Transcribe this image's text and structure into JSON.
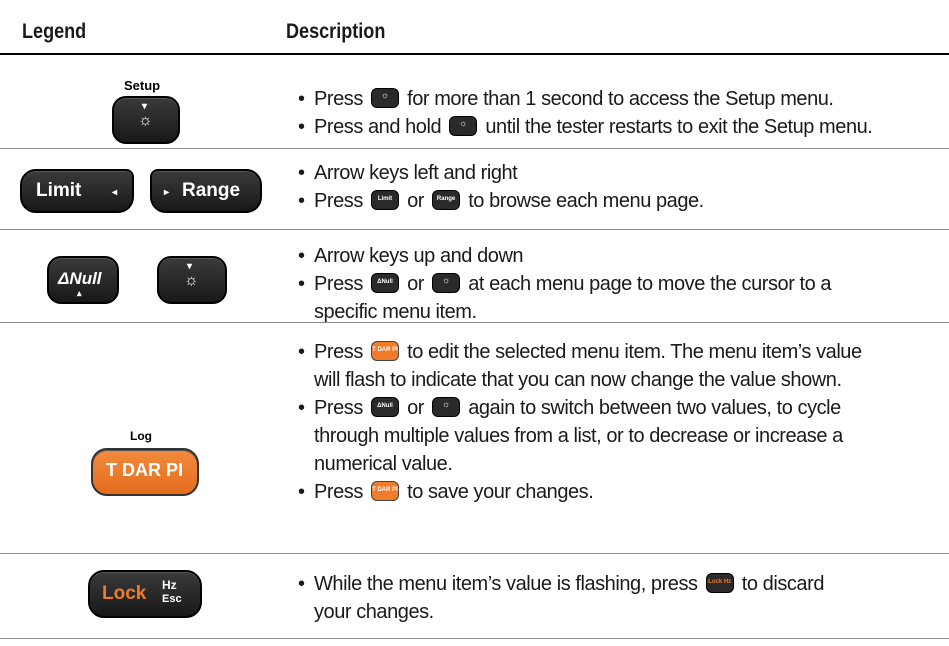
{
  "header": {
    "legend": "Legend",
    "description": "Description"
  },
  "rows": [
    {
      "keys": [
        {
          "above": "Setup",
          "arrow": "▾",
          "icon": "☼"
        }
      ],
      "bullets": [
        {
          "pre": "Press",
          "mini": "☼",
          "post": "for more than 1 second to access the Setup menu."
        },
        {
          "pre": "Press and hold",
          "mini": "☼",
          "post": "until the tester restarts to exit the Setup menu."
        }
      ]
    },
    {
      "keys": [
        {
          "label": "Limit",
          "arrow": "◂"
        },
        {
          "label": "Range",
          "arrow": "▸"
        }
      ],
      "bullets": [
        {
          "text": "Arrow keys left and right"
        },
        {
          "pre": "Press",
          "mini1": "Limit",
          "mid": "or",
          "mini2": "Range",
          "post": "to browse each menu page."
        }
      ]
    },
    {
      "keys": [
        {
          "label": "ΔNull",
          "arrow": "▴"
        },
        {
          "arrow": "▾",
          "icon": "☼"
        }
      ],
      "bullets": [
        {
          "text": "Arrow keys up and down"
        },
        {
          "pre": "Press",
          "mini1": "ΔNull",
          "mid": "or",
          "mini2": "☼",
          "post": "at each menu page to move the cursor to a",
          "post2": "specific menu item."
        }
      ]
    },
    {
      "keys": [
        {
          "above": "Log",
          "label": "T DAR PI"
        }
      ],
      "bullets": [
        {
          "pre": "Press",
          "mini": "T DAR PI",
          "post": "to edit the selected menu item. The menu item’s value",
          "post2": "will flash to indicate that you can now change the value shown."
        },
        {
          "pre": "Press",
          "mini1": "ΔNull",
          "mid": "or",
          "mini2": "☼",
          "post": "again to switch between two values, to cycle",
          "post2": "through multiple values from a list, or to decrease or increase a",
          "post3": "numerical value."
        },
        {
          "pre": "Press",
          "mini": "T DAR PI",
          "post": "to save your changes."
        }
      ]
    },
    {
      "keys": [
        {
          "label": "Lock",
          "sub1": "Hz",
          "sub2": "Esc"
        }
      ],
      "bullets": [
        {
          "pre": "While the menu item’s value is flashing, press",
          "mini": "Lock Hz",
          "post": "to discard",
          "post2": "your changes."
        }
      ]
    }
  ],
  "colors": {
    "key_dark": "#222222",
    "key_orange": "#ef7b2b",
    "rule": "#8c8c8c"
  }
}
